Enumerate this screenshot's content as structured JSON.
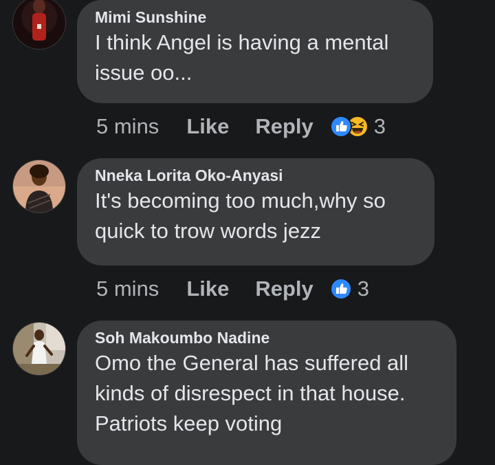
{
  "comments": [
    {
      "author": "Mimi Sunshine",
      "text_lines": [
        "I think Angel is having a mental",
        "issue oo..."
      ],
      "time": "5 mins",
      "like_label": "Like",
      "reply_label": "Reply",
      "reactions": [
        "like-icon",
        "haha-icon"
      ],
      "reaction_count": "3"
    },
    {
      "author": "Nneka Lorita Oko-Anyasi",
      "text_lines": [
        "It's becoming too much,why so",
        "quick to trow words jezz"
      ],
      "time": "5 mins",
      "like_label": "Like",
      "reply_label": "Reply",
      "reactions": [
        "like-icon"
      ],
      "reaction_count": "3"
    },
    {
      "author": "Soh Makoumbo Nadine",
      "text_lines": [
        "Omo the General has suffered all",
        "kinds of disrespect in that house.",
        "Patriots keep voting"
      ]
    }
  ],
  "colors": {
    "background": "#18191a",
    "bubble": "#3a3b3c",
    "text": "#e4e6eb",
    "secondary_text": "#b0b3b8",
    "like_blue": "#2e89ff",
    "haha_yellow": "#f7b928"
  }
}
